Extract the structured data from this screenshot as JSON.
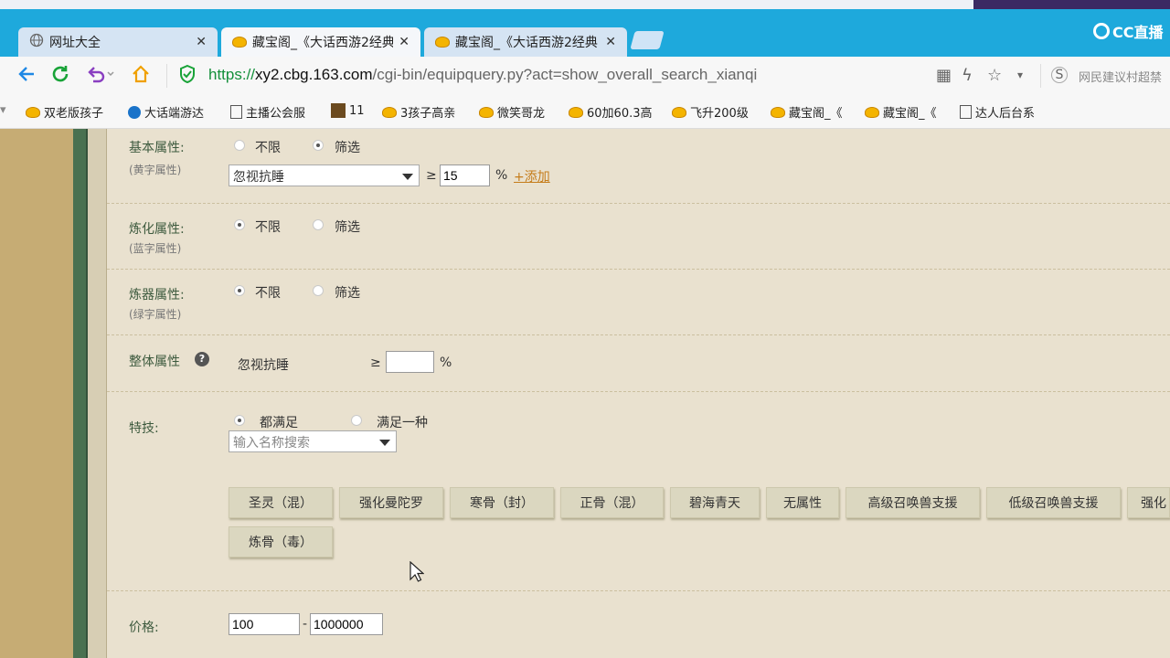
{
  "browser": {
    "tabs": [
      {
        "title": "网址大全",
        "close": "✕",
        "active": false
      },
      {
        "title": "藏宝阁_《大话西游2经典",
        "close": "✕",
        "active": true
      },
      {
        "title": "藏宝阁_《大话西游2经典",
        "close": "✕",
        "active": false
      }
    ],
    "brand": "CC直播",
    "url": {
      "scheme": "https://",
      "host": "xy2.cbg.163.com",
      "path": "/cgi-bin/equipquery.py?act=show_overall_search_xianqi"
    },
    "search_suggestion": "网民建议村超禁",
    "bookmarks": [
      "双老版孩子",
      "大话端游达",
      "主播公会服",
      "11",
      "3孩子高亲",
      "微笑哥龙",
      "60加60.3高",
      "飞升200级",
      "藏宝阁_《",
      "藏宝阁_《",
      "达人后台系"
    ]
  },
  "form": {
    "basic": {
      "label": "基本属性:",
      "sublabel": "(黄字属性)",
      "opt_all": "不限",
      "opt_filter": "筛选",
      "select_value": "忽视抗睡",
      "ge": "≥",
      "input_value": "15",
      "percent": "%",
      "add": "+添加"
    },
    "refine": {
      "label": "炼化属性:",
      "sublabel": "(蓝字属性)",
      "opt_all": "不限",
      "opt_filter": "筛选"
    },
    "artifact": {
      "label": "炼器属性:",
      "sublabel": "(绿字属性)",
      "opt_all": "不限",
      "opt_filter": "筛选"
    },
    "overall": {
      "label": "整体属性",
      "help": "?",
      "attr": "忽视抗睡",
      "ge": "≥",
      "input_value": "",
      "percent": "%"
    },
    "skills": {
      "label": "特技:",
      "opt_all": "都满足",
      "opt_one": "满足一种",
      "search_placeholder": "输入名称搜索",
      "buttons": [
        "圣灵（混）",
        "强化曼陀罗",
        "寒骨（封）",
        "正骨（混）",
        "碧海青天",
        "无属性",
        "高级召唤兽支援",
        "低级召唤兽支援",
        "强化",
        "炼骨（毒）"
      ]
    },
    "price": {
      "label": "价格:",
      "min": "100",
      "dash": "-",
      "max": "1000000"
    }
  }
}
